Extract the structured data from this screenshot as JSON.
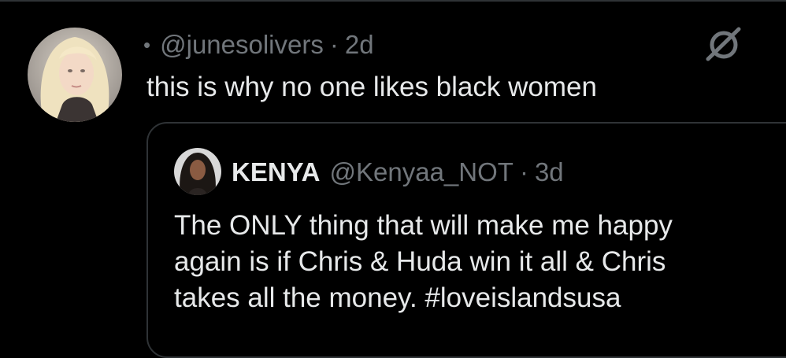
{
  "tweet": {
    "bullet": "•",
    "handle": "@junesolivers",
    "separator": "·",
    "time": "2d",
    "text": "this is why no one likes black women",
    "grok_icon": "grok-slash-icon"
  },
  "quote": {
    "name": "KENYA",
    "handle": "@Kenyaa_NOT",
    "separator": "·",
    "time": "3d",
    "text_lines": [
      "The ONLY thing that will make me happy",
      "again is if Chris & Huda win it all & Chris",
      "takes all the money. #loveislandsusa"
    ]
  },
  "colors": {
    "background": "#000000",
    "primary_text": "#e7e9ea",
    "secondary_text": "#71767b",
    "border": "#2f3336"
  }
}
